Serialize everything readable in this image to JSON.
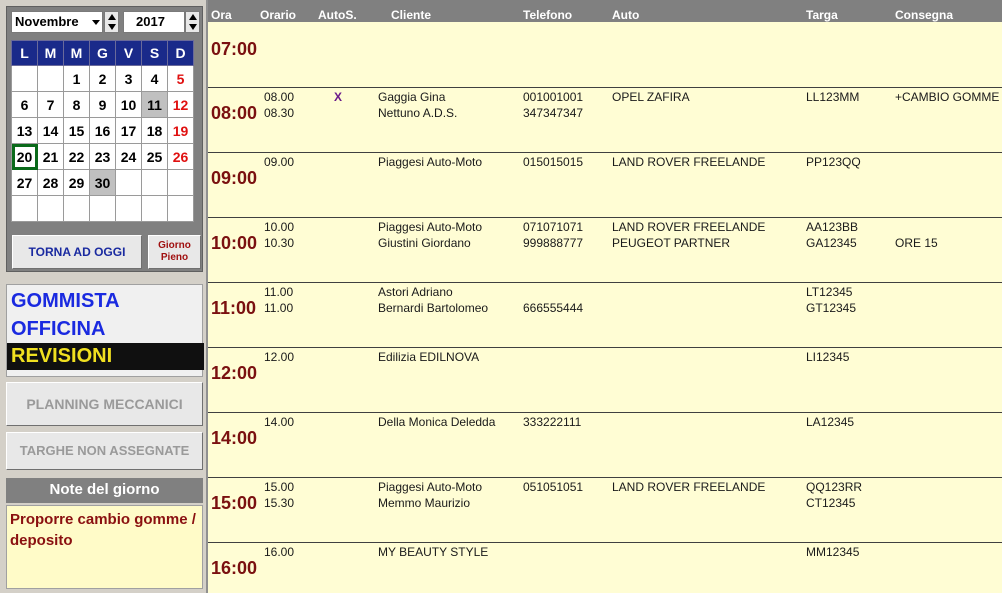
{
  "calendar": {
    "month": "Novembre",
    "year": "2017",
    "weekdays": [
      "L",
      "M",
      "M",
      "G",
      "V",
      "S",
      "D"
    ],
    "weeks": [
      [
        "",
        "",
        "1",
        "2",
        "3",
        "4",
        "5"
      ],
      [
        "6",
        "7",
        "8",
        "9",
        "10",
        "11",
        "12"
      ],
      [
        "13",
        "14",
        "15",
        "16",
        "17",
        "18",
        "19"
      ],
      [
        "20",
        "21",
        "22",
        "23",
        "24",
        "25",
        "26"
      ],
      [
        "27",
        "28",
        "29",
        "30",
        "",
        "",
        ""
      ],
      [
        "",
        "",
        "",
        "",
        "",
        "",
        ""
      ]
    ],
    "today_button": "TORNA AD OGGI",
    "full_day_button_line1": "Giorno",
    "full_day_button_line2": "Pieno"
  },
  "categories": [
    "GOMMISTA",
    "OFFICINA",
    "REVISIONI"
  ],
  "buttons": {
    "planning": "PLANNING MECCANICI",
    "targhe": "TARGHE NON ASSEGNATE"
  },
  "notes": {
    "title": "Note del giorno",
    "text": "Proporre cambio gomme / deposito"
  },
  "columns": {
    "ora": "Ora",
    "orario": "Orario",
    "autos": "AutoS.",
    "cliente": "Cliente",
    "telefono": "Telefono",
    "auto": "Auto",
    "targa": "Targa",
    "consegna": "Consegna"
  },
  "colors": {
    "hour_text": "#7a1010",
    "schedule_bg": "#fffdd4",
    "weekday_header_bg": "#1a2a8a",
    "sunday": "#e01010"
  },
  "slots": [
    {
      "hour": "07:00",
      "rows": []
    },
    {
      "hour": "08:00",
      "rows": [
        {
          "orario": "08.00",
          "autos": "X",
          "cliente": "Gaggia Gina",
          "telefono": "001001001",
          "auto": "OPEL ZAFIRA",
          "targa": "LL123MM",
          "consegna": "+CAMBIO GOMME"
        },
        {
          "orario": "08.30",
          "autos": "",
          "cliente": "Nettuno A.D.S.",
          "telefono": "347347347",
          "auto": "",
          "targa": "",
          "consegna": ""
        }
      ]
    },
    {
      "hour": "09:00",
      "rows": [
        {
          "orario": "09.00",
          "autos": "",
          "cliente": "Piaggesi Auto-Moto",
          "telefono": "015015015",
          "auto": "LAND ROVER FREELANDE",
          "targa": "PP123QQ",
          "consegna": ""
        }
      ]
    },
    {
      "hour": "10:00",
      "rows": [
        {
          "orario": "10.00",
          "autos": "",
          "cliente": "Piaggesi Auto-Moto",
          "telefono": "071071071",
          "auto": "LAND ROVER FREELANDE",
          "targa": "AA123BB",
          "consegna": ""
        },
        {
          "orario": "10.30",
          "autos": "",
          "cliente": "Giustini Giordano",
          "telefono": "999888777",
          "auto": "PEUGEOT PARTNER",
          "targa": "GA12345",
          "consegna": "ORE 15"
        }
      ]
    },
    {
      "hour": "11:00",
      "rows": [
        {
          "orario": "11.00",
          "autos": "",
          "cliente": "Astori Adriano",
          "telefono": "",
          "auto": "",
          "targa": "LT12345",
          "consegna": ""
        },
        {
          "orario": "11.00",
          "autos": "",
          "cliente": "Bernardi Bartolomeo",
          "telefono": "666555444",
          "auto": "",
          "targa": "GT12345",
          "consegna": ""
        }
      ]
    },
    {
      "hour": "12:00",
      "rows": [
        {
          "orario": "12.00",
          "autos": "",
          "cliente": "Edilizia EDILNOVA",
          "telefono": "",
          "auto": "",
          "targa": "LI12345",
          "consegna": ""
        }
      ]
    },
    {
      "hour": "14:00",
      "rows": [
        {
          "orario": "14.00",
          "autos": "",
          "cliente": "Della Monica Deledda",
          "telefono": "333222111",
          "auto": "",
          "targa": "LA12345",
          "consegna": ""
        }
      ]
    },
    {
      "hour": "15:00",
      "rows": [
        {
          "orario": "15.00",
          "autos": "",
          "cliente": "Piaggesi Auto-Moto",
          "telefono": "051051051",
          "auto": "LAND ROVER FREELANDE",
          "targa": "QQ123RR",
          "consegna": ""
        },
        {
          "orario": "15.30",
          "autos": "",
          "cliente": "Memmo Maurizio",
          "telefono": "",
          "auto": "",
          "targa": "CT12345",
          "consegna": ""
        }
      ]
    },
    {
      "hour": "16:00",
      "rows": [
        {
          "orario": "16.00",
          "autos": "",
          "cliente": "MY BEAUTY STYLE",
          "telefono": "",
          "auto": "",
          "targa": "MM12345",
          "consegna": ""
        }
      ]
    }
  ]
}
